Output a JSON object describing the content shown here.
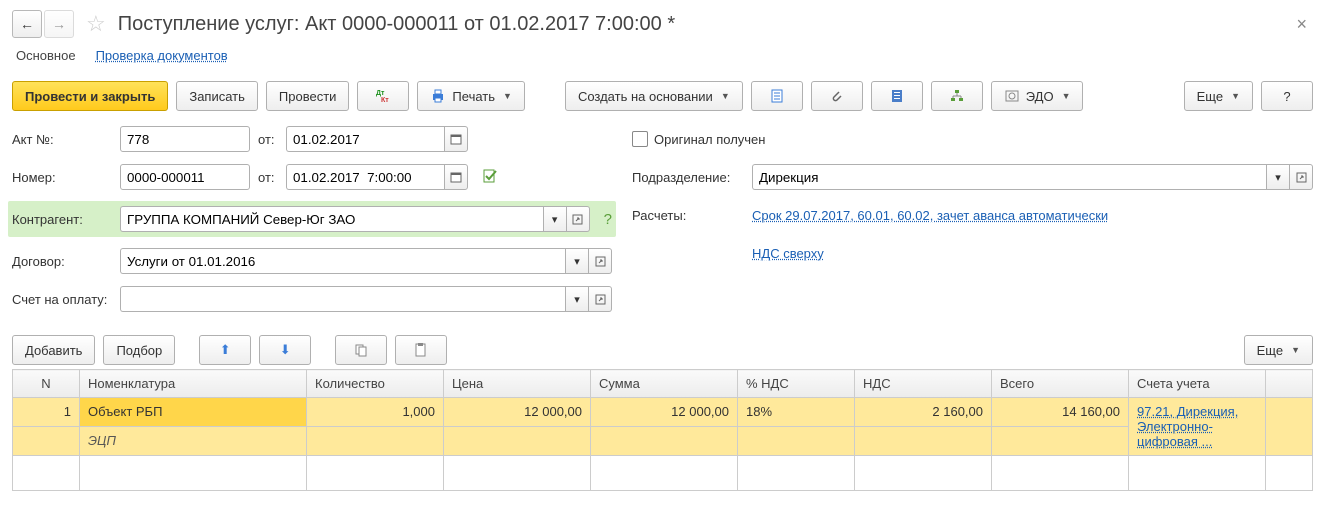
{
  "header": {
    "title": "Поступление услуг: Акт 0000-000011 от 01.02.2017 7:00:00 *"
  },
  "tabs": {
    "main": "Основное",
    "check": "Проверка документов"
  },
  "toolbar": {
    "post_close": "Провести и закрыть",
    "save": "Записать",
    "post": "Провести",
    "print": "Печать",
    "create_based": "Создать на основании",
    "edo": "ЭДО",
    "more": "Еще"
  },
  "form": {
    "act_no_label": "Акт №:",
    "act_no": "778",
    "from_label": "от:",
    "act_date": "01.02.2017",
    "number_label": "Номер:",
    "number": "0000-000011",
    "number_date": "01.02.2017  7:00:00",
    "contractor_label": "Контрагент:",
    "contractor": "ГРУППА КОМПАНИЙ Север-Юг ЗАО",
    "contract_label": "Договор:",
    "contract": "Услуги от 01.01.2016",
    "invoice_label": "Счет на оплату:",
    "invoice": "",
    "original_label": "Оригинал получен",
    "division_label": "Подразделение:",
    "division": "Дирекция",
    "calc_label": "Расчеты:",
    "calc_link": "Срок 29.07.2017, 60.01, 60.02, зачет аванса автоматически",
    "vat_link": "НДС сверху"
  },
  "tbl_toolbar": {
    "add": "Добавить",
    "select": "Подбор",
    "more": "Еще"
  },
  "table": {
    "headers": {
      "n": "N",
      "nomenclature": "Номенклатура",
      "qty": "Количество",
      "price": "Цена",
      "sum": "Сумма",
      "vat_pct": "% НДС",
      "vat": "НДС",
      "total": "Всего",
      "accounts": "Счета учета"
    },
    "rows": [
      {
        "n": "1",
        "nomenclature": "Объект РБП",
        "sub": "ЭЦП",
        "qty": "1,000",
        "price": "12 000,00",
        "sum": "12 000,00",
        "vat_pct": "18%",
        "vat": "2 160,00",
        "total": "14 160,00",
        "accounts": "97.21, Дирекция, Электронно-цифровая ..."
      }
    ]
  }
}
